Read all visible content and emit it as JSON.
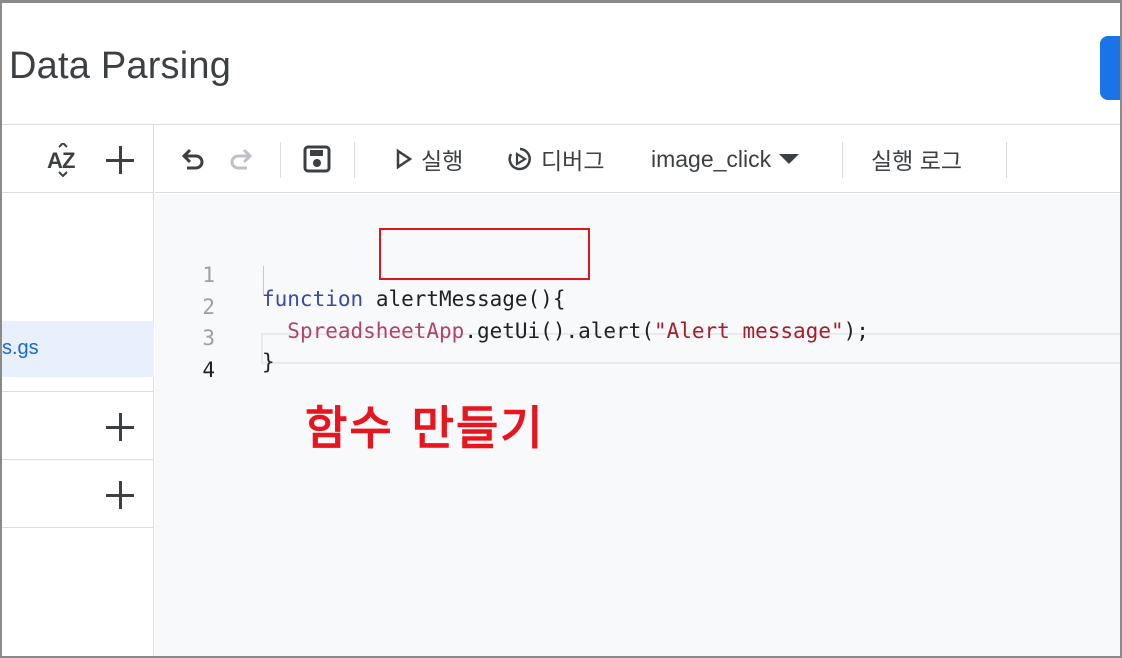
{
  "header": {
    "title": "Data Parsing"
  },
  "left_panel": {
    "file_label": "s.gs"
  },
  "toolbar": {
    "run_label": "실행",
    "debug_label": "디버그",
    "function_select": "image_click",
    "execution_log_label": "실행 로그"
  },
  "editor": {
    "line_numbers": [
      "1",
      "2",
      "3",
      "4"
    ],
    "line1": {
      "keyword": "function",
      "name": "alertMessage",
      "tail": "(){"
    },
    "line2": {
      "indent": "  ",
      "object": "SpreadsheetApp",
      "mid": ".getUi().alert(",
      "string": "\"Alert message\"",
      "tail": ");"
    },
    "line3": "}"
  },
  "annotation": {
    "text": "함수 만들기",
    "color": "#e8141e"
  },
  "colors": {
    "accent": "#1a73e8",
    "highlight_box": "#e0141e",
    "keyword": "#3949ab",
    "class_name": "#b0426d",
    "string": "#a61c2b"
  }
}
